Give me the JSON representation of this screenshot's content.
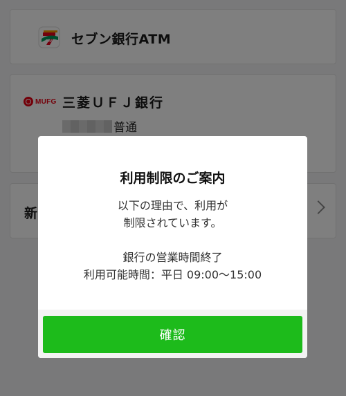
{
  "accounts": [
    {
      "name": "セブン銀行ATM",
      "logo": "seven-bank-logo"
    },
    {
      "name": "三菱ＵＦＪ銀行",
      "logo": "mufg-logo",
      "logo_text": "MUFG",
      "account_type": "普通"
    },
    {
      "name": "新"
    }
  ],
  "modal": {
    "title": "利用制限のご案内",
    "body_lines": [
      "以下の理由で、利用が",
      "制限されています。"
    ],
    "reason_lines": [
      "銀行の営業時間終了",
      "利用可能時間：平日 09:00〜15:00"
    ],
    "confirm_label": "確認"
  },
  "colors": {
    "confirm_button": "#1dbb1b",
    "mufg_red": "#e60012",
    "overlay": "rgba(0,0,0,0.5)"
  }
}
